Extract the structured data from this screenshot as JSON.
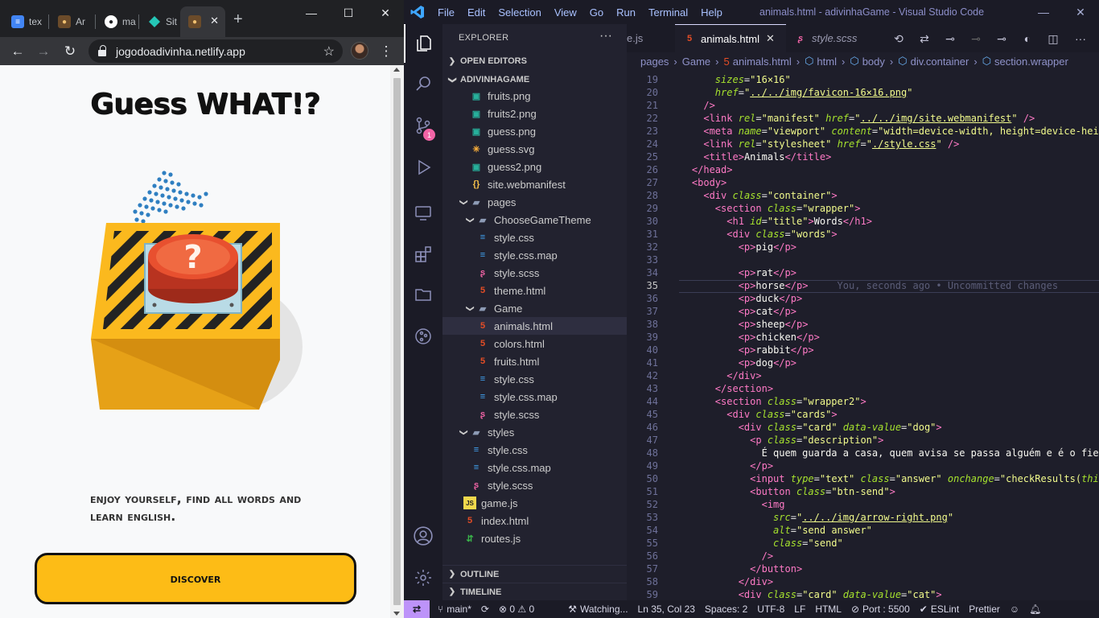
{
  "browser": {
    "tabs": [
      {
        "label": "tex",
        "favicon": "docs-icon"
      },
      {
        "label": "Ar",
        "favicon": "fox-icon"
      },
      {
        "label": "ma",
        "favicon": "github-icon"
      },
      {
        "label": "Sit",
        "favicon": "netlify-icon"
      },
      {
        "label": "",
        "favicon": "fox-icon",
        "active": true
      }
    ],
    "url": "jogodoadivinha.netlify.app",
    "page": {
      "title": "Guess WHAT!?",
      "text": "Enjoy yourself, find all words and learn english.",
      "button": "Discover"
    }
  },
  "vscode": {
    "menu": [
      "File",
      "Edit",
      "Selection",
      "View",
      "Go",
      "Run",
      "Terminal",
      "Help"
    ],
    "window_title": "animals.html - adivinhaGame - Visual Studio Code",
    "explorer": {
      "title": "EXPLORER",
      "sections": {
        "open_editors": "OPEN EDITORS",
        "project": "ADIVINHAGAME",
        "outline": "OUTLINE",
        "timeline": "TIMELINE"
      },
      "files": [
        {
          "name": "fruits.png",
          "icon": "image",
          "depth": 1
        },
        {
          "name": "fruits2.png",
          "icon": "image",
          "depth": 1
        },
        {
          "name": "guess.png",
          "icon": "image",
          "depth": 1
        },
        {
          "name": "guess.svg",
          "icon": "svg",
          "depth": 1
        },
        {
          "name": "guess2.png",
          "icon": "image",
          "depth": 1
        },
        {
          "name": "site.webmanifest",
          "icon": "json",
          "depth": 1
        },
        {
          "name": "pages",
          "icon": "folder",
          "depth": 0,
          "open": true
        },
        {
          "name": "ChooseGameTheme",
          "icon": "folder",
          "depth": 1,
          "open": true
        },
        {
          "name": "style.css",
          "icon": "css",
          "depth": 2
        },
        {
          "name": "style.css.map",
          "icon": "map",
          "depth": 2
        },
        {
          "name": "style.scss",
          "icon": "scss",
          "depth": 2
        },
        {
          "name": "theme.html",
          "icon": "html",
          "depth": 2
        },
        {
          "name": "Game",
          "icon": "folder",
          "depth": 1,
          "open": true
        },
        {
          "name": "animals.html",
          "icon": "html",
          "depth": 2,
          "selected": true
        },
        {
          "name": "colors.html",
          "icon": "html",
          "depth": 2
        },
        {
          "name": "fruits.html",
          "icon": "html",
          "depth": 2
        },
        {
          "name": "style.css",
          "icon": "css",
          "depth": 2
        },
        {
          "name": "style.css.map",
          "icon": "map",
          "depth": 2
        },
        {
          "name": "style.scss",
          "icon": "scss",
          "depth": 2
        },
        {
          "name": "styles",
          "icon": "folder",
          "depth": 0,
          "open": true
        },
        {
          "name": "style.css",
          "icon": "css",
          "depth": 1
        },
        {
          "name": "style.css.map",
          "icon": "map",
          "depth": 1
        },
        {
          "name": "style.scss",
          "icon": "scss",
          "depth": 1
        },
        {
          "name": "game.js",
          "icon": "js",
          "depth": 0
        },
        {
          "name": "index.html",
          "icon": "html",
          "depth": 0
        },
        {
          "name": "routes.js",
          "icon": "routes",
          "depth": 0
        }
      ]
    },
    "editor_tabs": [
      {
        "label": "e.js",
        "icon": "",
        "active": false
      },
      {
        "label": "animals.html",
        "icon": "html",
        "active": true
      },
      {
        "label": "style.scss",
        "icon": "scss",
        "active": false
      }
    ],
    "breadcrumbs": [
      "pages",
      "Game",
      "animals.html",
      "html",
      "body",
      "div.container",
      "section.wrapper"
    ],
    "code_lines": [
      {
        "n": "19",
        "html": "        <span class=\"at\">sizes</span>=<span class=\"sv\">\"16×16\"</span>"
      },
      {
        "n": "20",
        "html": "        <span class=\"at\">href</span>=<span class=\"sv\">\"<span class=\"ul\">../../img/favicon-16×16.png</span>\"</span>"
      },
      {
        "n": "21",
        "html": "      <span class=\"tg\">/&gt;</span>"
      },
      {
        "n": "22",
        "html": "      <span class=\"tg\">&lt;link</span> <span class=\"at\">rel</span>=<span class=\"sv\">\"manifest\"</span> <span class=\"at\">href</span>=<span class=\"sv\">\"<span class=\"ul\">../../img/site.webmanifest</span>\"</span> <span class=\"tg\">/&gt;</span>"
      },
      {
        "n": "23",
        "html": "      <span class=\"tg\">&lt;meta</span> <span class=\"at\">name</span>=<span class=\"sv\">\"viewport\"</span> <span class=\"at\">content</span>=<span class=\"sv\">\"width=device-width, height=device-heig</span>"
      },
      {
        "n": "24",
        "html": "      <span class=\"tg\">&lt;link</span> <span class=\"at\">rel</span>=<span class=\"sv\">\"stylesheet\"</span> <span class=\"at\">href</span>=<span class=\"sv\">\"<span class=\"ul\">./style.css</span>\"</span> <span class=\"tg\">/&gt;</span>"
      },
      {
        "n": "25",
        "html": "      <span class=\"tg\">&lt;title&gt;</span><span class=\"tx\">Animals</span><span class=\"tg\">&lt;/title&gt;</span>"
      },
      {
        "n": "26",
        "html": "    <span class=\"tg\">&lt;/head&gt;</span>"
      },
      {
        "n": "27",
        "html": "    <span class=\"tg\">&lt;body&gt;</span>"
      },
      {
        "n": "28",
        "html": "      <span class=\"tg\">&lt;div</span> <span class=\"at\">class</span>=<span class=\"sv\">\"container\"</span><span class=\"tg\">&gt;</span>"
      },
      {
        "n": "29",
        "html": "        <span class=\"tg\">&lt;section</span> <span class=\"at\">class</span>=<span class=\"sv\">\"wrapper\"</span><span class=\"tg\">&gt;</span>"
      },
      {
        "n": "30",
        "html": "          <span class=\"tg\">&lt;h1</span> <span class=\"at\">id</span>=<span class=\"sv\">\"title\"</span><span class=\"tg\">&gt;</span><span class=\"tx\">Words</span><span class=\"tg\">&lt;/h1&gt;</span>"
      },
      {
        "n": "31",
        "html": "          <span class=\"tg\">&lt;div</span> <span class=\"at\">class</span>=<span class=\"sv\">\"words\"</span><span class=\"tg\">&gt;</span>"
      },
      {
        "n": "32",
        "html": "            <span class=\"tg\">&lt;p&gt;</span><span class=\"tx\">pig</span><span class=\"tg\">&lt;/p&gt;</span>"
      },
      {
        "n": "33",
        "html": ""
      },
      {
        "n": "34",
        "html": "            <span class=\"tg\">&lt;p&gt;</span><span class=\"tx\">rat</span><span class=\"tg\">&lt;/p&gt;</span>"
      },
      {
        "n": "35",
        "html": "            <span class=\"tg\">&lt;p&gt;</span><span class=\"tx\">horse</span><span class=\"tg\">&lt;/p&gt;</span>     <span class=\"blame\">You, seconds ago • Uncommitted changes</span>",
        "current": true
      },
      {
        "n": "36",
        "html": "            <span class=\"tg\">&lt;p&gt;</span><span class=\"tx\">duck</span><span class=\"tg\">&lt;/p&gt;</span>"
      },
      {
        "n": "37",
        "html": "            <span class=\"tg\">&lt;p&gt;</span><span class=\"tx\">cat</span><span class=\"tg\">&lt;/p&gt;</span>"
      },
      {
        "n": "38",
        "html": "            <span class=\"tg\">&lt;p&gt;</span><span class=\"tx\">sheep</span><span class=\"tg\">&lt;/p&gt;</span>"
      },
      {
        "n": "39",
        "html": "            <span class=\"tg\">&lt;p&gt;</span><span class=\"tx\">chicken</span><span class=\"tg\">&lt;/p&gt;</span>"
      },
      {
        "n": "40",
        "html": "            <span class=\"tg\">&lt;p&gt;</span><span class=\"tx\">rabbit</span><span class=\"tg\">&lt;/p&gt;</span>"
      },
      {
        "n": "41",
        "html": "            <span class=\"tg\">&lt;p&gt;</span><span class=\"tx\">dog</span><span class=\"tg\">&lt;/p&gt;</span>"
      },
      {
        "n": "42",
        "html": "          <span class=\"tg\">&lt;/div&gt;</span>"
      },
      {
        "n": "43",
        "html": "        <span class=\"tg\">&lt;/section&gt;</span>"
      },
      {
        "n": "44",
        "html": "        <span class=\"tg\">&lt;section</span> <span class=\"at\">class</span>=<span class=\"sv\">\"wrapper2\"</span><span class=\"tg\">&gt;</span>"
      },
      {
        "n": "45",
        "html": "          <span class=\"tg\">&lt;div</span> <span class=\"at\">class</span>=<span class=\"sv\">\"cards\"</span><span class=\"tg\">&gt;</span>"
      },
      {
        "n": "46",
        "html": "            <span class=\"tg\">&lt;div</span> <span class=\"at\">class</span>=<span class=\"sv\">\"card\"</span> <span class=\"at\">data-value</span>=<span class=\"sv\">\"dog\"</span><span class=\"tg\">&gt;</span>"
      },
      {
        "n": "47",
        "html": "              <span class=\"tg\">&lt;p</span> <span class=\"at\">class</span>=<span class=\"sv\">\"description\"</span><span class=\"tg\">&gt;</span>"
      },
      {
        "n": "48",
        "html": "                <span class=\"tx\">É quem guarda a casa, quem avisa se passa alguém e é o fiel</span>"
      },
      {
        "n": "49",
        "html": "              <span class=\"tg\">&lt;/p&gt;</span>"
      },
      {
        "n": "50",
        "html": "              <span class=\"tg\">&lt;input</span> <span class=\"at\">type</span>=<span class=\"sv\">\"text\"</span> <span class=\"at\">class</span>=<span class=\"sv\">\"answer\"</span> <span class=\"at\">onchange</span>=<span class=\"sv\">\"checkResults(</span><span class=\"at\">this</span>"
      },
      {
        "n": "51",
        "html": "              <span class=\"tg\">&lt;button</span> <span class=\"at\">class</span>=<span class=\"sv\">\"btn-send\"</span><span class=\"tg\">&gt;</span>"
      },
      {
        "n": "52",
        "html": "                <span class=\"tg\">&lt;img</span>"
      },
      {
        "n": "53",
        "html": "                  <span class=\"at\">src</span>=<span class=\"sv\">\"<span class=\"ul\">../../img/arrow-right.png</span>\"</span>"
      },
      {
        "n": "54",
        "html": "                  <span class=\"at\">alt</span>=<span class=\"sv\">\"send answer\"</span>"
      },
      {
        "n": "55",
        "html": "                  <span class=\"at\">class</span>=<span class=\"sv\">\"send\"</span>"
      },
      {
        "n": "56",
        "html": "                <span class=\"tg\">/&gt;</span>"
      },
      {
        "n": "57",
        "html": "              <span class=\"tg\">&lt;/button&gt;</span>"
      },
      {
        "n": "58",
        "html": "            <span class=\"tg\">&lt;/div&gt;</span>"
      },
      {
        "n": "59",
        "html": "            <span class=\"tg\">&lt;div</span> <span class=\"at\">class</span>=<span class=\"sv\">\"card\"</span> <span class=\"at\">data-value</span>=<span class=\"sv\">\"cat\"</span><span class=\"tg\">&gt;</span>"
      }
    ],
    "status": {
      "branch": "main*",
      "problems": "0",
      "warnings": "0",
      "watching": "Watching...",
      "position": "Ln 35, Col 23",
      "spaces": "Spaces: 2",
      "encoding": "UTF-8",
      "eol": "LF",
      "language": "HTML",
      "port": "Port : 5500",
      "eslint": "ESLint",
      "prettier": "Prettier"
    }
  }
}
